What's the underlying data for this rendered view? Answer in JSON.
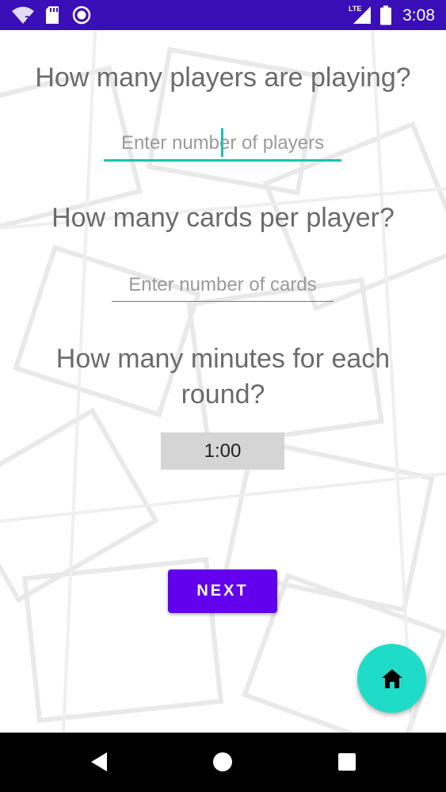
{
  "status_bar": {
    "time": "3:08",
    "network_label": "LTE",
    "background_color": "#3a0fb8",
    "icons": [
      "wifi-question-icon",
      "sd-card-icon",
      "circle-record-icon",
      "lte-signal-icon",
      "battery-icon"
    ]
  },
  "form": {
    "players": {
      "question": "How many players are playing?",
      "placeholder": "Enter number of players",
      "value": ""
    },
    "cards": {
      "question": "How many cards per player?",
      "placeholder": "Enter number of cards",
      "value": ""
    },
    "minutes": {
      "question_line1": "How many minutes for each",
      "question_line2": "round?",
      "value": "1:00"
    }
  },
  "next_button": {
    "label": "NEXT",
    "color": "#6200ee"
  },
  "fab": {
    "icon": "home-icon",
    "color": "#1fdcc8"
  },
  "nav_bar": {
    "icons": [
      "back-triangle-icon",
      "home-circle-icon",
      "recents-square-icon"
    ]
  },
  "accent_color": "#19c3b1"
}
